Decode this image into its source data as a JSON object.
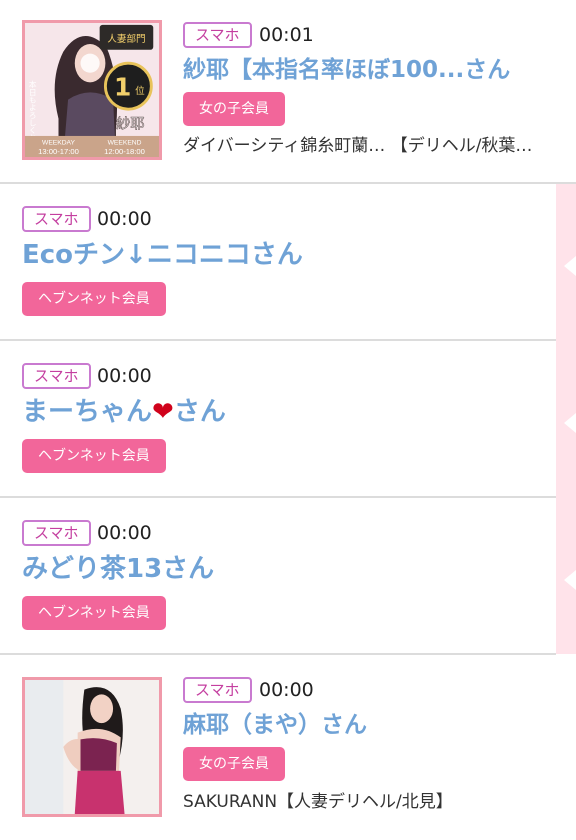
{
  "items": [
    {
      "device": "スマホ",
      "time": "00:01",
      "name": "紗耶【本指名率ほぼ100...さん",
      "member": "女の子会員",
      "shop": "ダイバーシティ錦糸町蘭… 【デリヘル/秋葉…",
      "avatar_texts": {
        "ribbon": "人妻部門",
        "rank_num": "1",
        "rank_unit": "位",
        "girl_name": "紗耶",
        "left_a": "WEEKDAY",
        "left_b": "13:00-17:00",
        "right_a": "WEEKEND",
        "right_b": "12:00-18:00",
        "vertical": "本日もよろしくお願いします"
      }
    },
    {
      "device": "スマホ",
      "time": "00:00",
      "name": "Ecoチン↓ニコニコさん",
      "member": "ヘブンネット会員"
    },
    {
      "device": "スマホ",
      "time": "00:00",
      "name_before": "まーちゃん",
      "name_heart": "❤",
      "name_after": "さん",
      "member": "ヘブンネット会員"
    },
    {
      "device": "スマホ",
      "time": "00:00",
      "name": "みどり茶13さん",
      "member": "ヘブンネット会員"
    },
    {
      "device": "スマホ",
      "time": "00:00",
      "name": "麻耶（まや）さん",
      "member": "女の子会員",
      "shop": "SAKURANN【人妻デリヘル/北見】"
    }
  ],
  "colors": {
    "name": "#6fa2d6",
    "member_badge": "#f2669a",
    "device_border": "#c97ad0",
    "avatar_border": "#f09aaa",
    "side_strip": "#ffe3ea"
  }
}
